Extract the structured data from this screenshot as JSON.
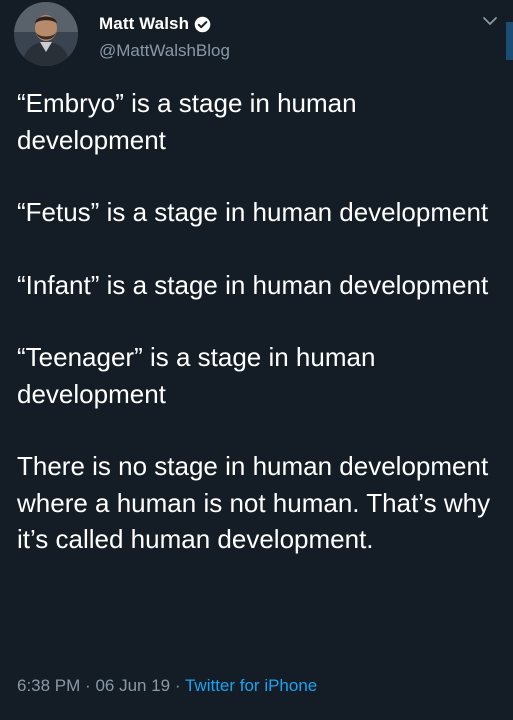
{
  "tweet": {
    "author": {
      "display_name": "Matt Walsh",
      "handle": "@MattWalshBlog",
      "verified": true
    },
    "paragraphs": [
      "“Embryo” is a stage in human development",
      "“Fetus” is a stage in human development",
      "“Infant” is a stage in human development",
      "“Teenager” is a stage in human development",
      "There is no stage in human development where a human is not human. That’s why it’s called human development."
    ],
    "meta": {
      "time": "6:38 PM",
      "separator": "·",
      "date": "06 Jun 19",
      "source": "Twitter for iPhone"
    }
  },
  "colors": {
    "background": "#141d26",
    "text": "#ffffff",
    "secondary_text": "#8899a6",
    "link": "#1da1f2"
  },
  "icons": {
    "verified": "verified-badge-icon",
    "menu": "chevron-down-icon"
  }
}
